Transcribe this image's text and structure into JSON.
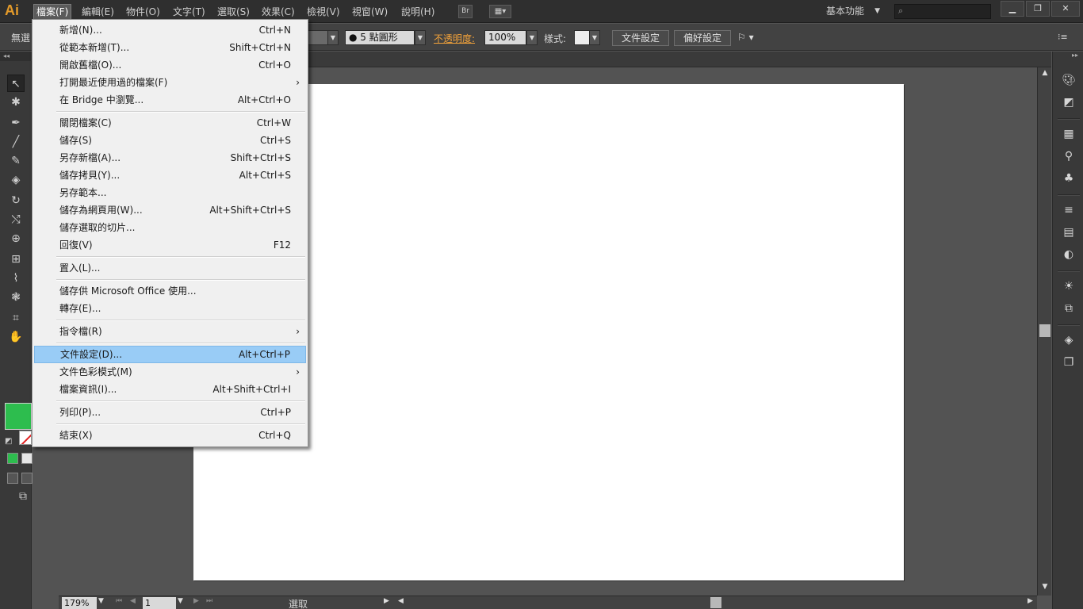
{
  "app": {
    "logo": "Ai"
  },
  "menubar": {
    "items": [
      {
        "label": "檔案(F)"
      },
      {
        "label": "編輯(E)"
      },
      {
        "label": "物件(O)"
      },
      {
        "label": "文字(T)"
      },
      {
        "label": "選取(S)"
      },
      {
        "label": "效果(C)"
      },
      {
        "label": "檢視(V)"
      },
      {
        "label": "視窗(W)"
      },
      {
        "label": "說明(H)"
      }
    ],
    "bridge_button": "Br",
    "workspace": "基本功能",
    "search_placeholder": ""
  },
  "control_bar": {
    "selection_state": "無選",
    "brush_value": "● 5 點圓形",
    "opacity_label": "不透明度:",
    "opacity_value": "100%",
    "style_label": "樣式:",
    "doc_setup_button": "文件設定",
    "preferences_button": "偏好設定"
  },
  "file_menu": {
    "groups": [
      [
        {
          "label": "新增(N)...",
          "shortcut": "Ctrl+N"
        },
        {
          "label": "從範本新增(T)...",
          "shortcut": "Shift+Ctrl+N"
        },
        {
          "label": "開啟舊檔(O)...",
          "shortcut": "Ctrl+O"
        },
        {
          "label": "打開最近使用過的檔案(F)",
          "shortcut": "",
          "submenu": true
        },
        {
          "label": "在 Bridge 中瀏覽...",
          "shortcut": "Alt+Ctrl+O"
        }
      ],
      [
        {
          "label": "關閉檔案(C)",
          "shortcut": "Ctrl+W"
        },
        {
          "label": "儲存(S)",
          "shortcut": "Ctrl+S"
        },
        {
          "label": "另存新檔(A)...",
          "shortcut": "Shift+Ctrl+S"
        },
        {
          "label": "儲存拷貝(Y)...",
          "shortcut": "Alt+Ctrl+S"
        },
        {
          "label": "另存範本...",
          "shortcut": ""
        },
        {
          "label": "儲存為網頁用(W)...",
          "shortcut": "Alt+Shift+Ctrl+S"
        },
        {
          "label": "儲存選取的切片...",
          "shortcut": ""
        },
        {
          "label": "回復(V)",
          "shortcut": "F12"
        }
      ],
      [
        {
          "label": "置入(L)...",
          "shortcut": ""
        }
      ],
      [
        {
          "label": "儲存供 Microsoft Office 使用...",
          "shortcut": ""
        },
        {
          "label": "轉存(E)...",
          "shortcut": ""
        }
      ],
      [
        {
          "label": "指令檔(R)",
          "shortcut": "",
          "submenu": true
        }
      ],
      [
        {
          "label": "文件設定(D)...",
          "shortcut": "Alt+Ctrl+P",
          "highlighted": true
        },
        {
          "label": "文件色彩模式(M)",
          "shortcut": "",
          "submenu": true
        },
        {
          "label": "檔案資訊(I)...",
          "shortcut": "Alt+Shift+Ctrl+I"
        }
      ],
      [
        {
          "label": "列印(P)...",
          "shortcut": "Ctrl+P"
        }
      ],
      [
        {
          "label": "結束(X)",
          "shortcut": "Ctrl+Q"
        }
      ]
    ]
  },
  "status_bar": {
    "zoom": "179%",
    "page": "1",
    "status_text": "選取"
  },
  "colors": {
    "fill": "#2dbd4e",
    "menu_highlight": "#99ccf6",
    "accent_orange": "#f2a23a"
  }
}
